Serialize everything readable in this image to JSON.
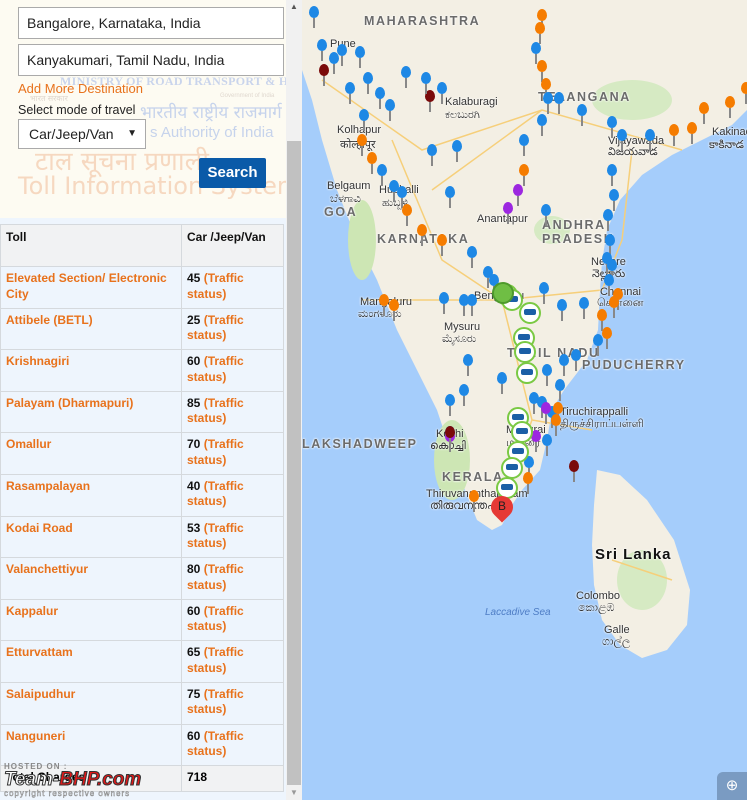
{
  "form": {
    "from_value": "Bangalore, Karnataka, India",
    "to_value": "Kanyakumari, Tamil Nadu, India",
    "add_destination_label": "Add More Destination",
    "mode_label": "Select mode of travel",
    "mode_selected": "Car/Jeep/Van",
    "search_label": "Search"
  },
  "background_watermark": {
    "line1": "MINISTRY OF ROAD TRANSPORT & HIGHWAYS",
    "line2": "भारत सरकार",
    "line2b": "Government of India",
    "line3": "भारतीय राष्ट्रीय राजमार्ग प्राधिकरण",
    "line4": "s Authority of India",
    "line5": "टाल सूचना प्रणाली",
    "line6": "Toll Information System"
  },
  "table": {
    "headers": [
      "Toll",
      "Car /Jeep/Van"
    ],
    "traffic_label": "(Traffic status)",
    "rows": [
      {
        "name": "Elevated Section/ Electronic City",
        "value": "45"
      },
      {
        "name": "Attibele (BETL)",
        "value": "25"
      },
      {
        "name": "Krishnagiri",
        "value": "60"
      },
      {
        "name": "Palayam (Dharmapuri)",
        "value": "85"
      },
      {
        "name": "Omallur",
        "value": "70"
      },
      {
        "name": "Rasampalayan",
        "value": "40"
      },
      {
        "name": "Kodai Road",
        "value": "53"
      },
      {
        "name": "Valanchettiyur",
        "value": "80"
      },
      {
        "name": "Kappalur",
        "value": "60"
      },
      {
        "name": "Etturvattam",
        "value": "65"
      },
      {
        "name": "Salaipudhur",
        "value": "75"
      },
      {
        "name": "Nanguneri",
        "value": "60"
      }
    ],
    "total_label": "Total Charges",
    "total_value": "718"
  },
  "map": {
    "labels": {
      "maharashtra": "MAHARASHTRA",
      "telangana": "TELANGANA",
      "karnataka": "KARNATAKA",
      "andhra": "ANDHRA",
      "pradesh": "PRADESH",
      "goa": "GOA",
      "tamil_nadu": "TAMIL NADU",
      "puducherry": "PUDUCHERRY",
      "kerala": "KERALA",
      "lakshadweep": "LAKSHADWEEP",
      "laccadive": "Laccadive Sea",
      "sri_lanka": "Sri Lanka",
      "pune": "Pune",
      "kalaburagi": "Kalaburagi",
      "kalaburagi_local": "ಕಲಬುರಗಿ",
      "kolhapur": "Kolhapur",
      "kolhapur_local": "कोल्हापूर",
      "belgaum": "Belgaum",
      "belgaum_local": "ಬೆಳಗಾವಿ",
      "hubballi": "Hubballi",
      "hubballi_local": "ಹುಬ್ಬಳ್ಳಿ",
      "anantapur": "Anantapur",
      "vijayawada": "Vijayawada",
      "vijayawada_local": "విజయవాడ",
      "kakinada": "Kakinada",
      "kakinada_local": "కాకినాడ",
      "nellore": "Nellore",
      "nellore_local": "నెల్లూరు",
      "chennai": "Chennai",
      "chennai_local": "சென்னை",
      "bengaluru": "Bengaluru",
      "mangaluru": "Mangaluru",
      "mangaluru_local": "ಮಂಗಳೂರು",
      "mysuru": "Mysuru",
      "mysuru_local": "ಮೈಸೂರು",
      "kochi": "Kochi",
      "kochi_local": "കൊച്ചി",
      "tiruchirappalli": "Tiruchirappalli",
      "tiruchirappalli_local": "திருச்சிராப்பள்ளி",
      "madurai": "Madurai",
      "madurai_local": "மதுரை",
      "thiruvananthapuram": "Thiruvananthapuram",
      "thiruvananthapuram_local": "തിരുവനന്തപുരം",
      "colombo": "Colombo",
      "colombo_local": "කොළඹ",
      "galle": "Galle",
      "galle_local": "ගාල්ල"
    },
    "destination_marker_label": "B",
    "marker_colors": {
      "blue": "#1e88e5",
      "orange": "#f57c00",
      "purple": "#9c27e0",
      "maroon": "#7a0a0a",
      "toll": "#7ac943",
      "dest": "#e53935"
    },
    "zoom_icon": "zoom-in-icon"
  },
  "watermark": {
    "hosted": "HOSTED ON :",
    "team": "Team-",
    "bhp": "BHP.com",
    "copyright": "copyright respective owners"
  }
}
